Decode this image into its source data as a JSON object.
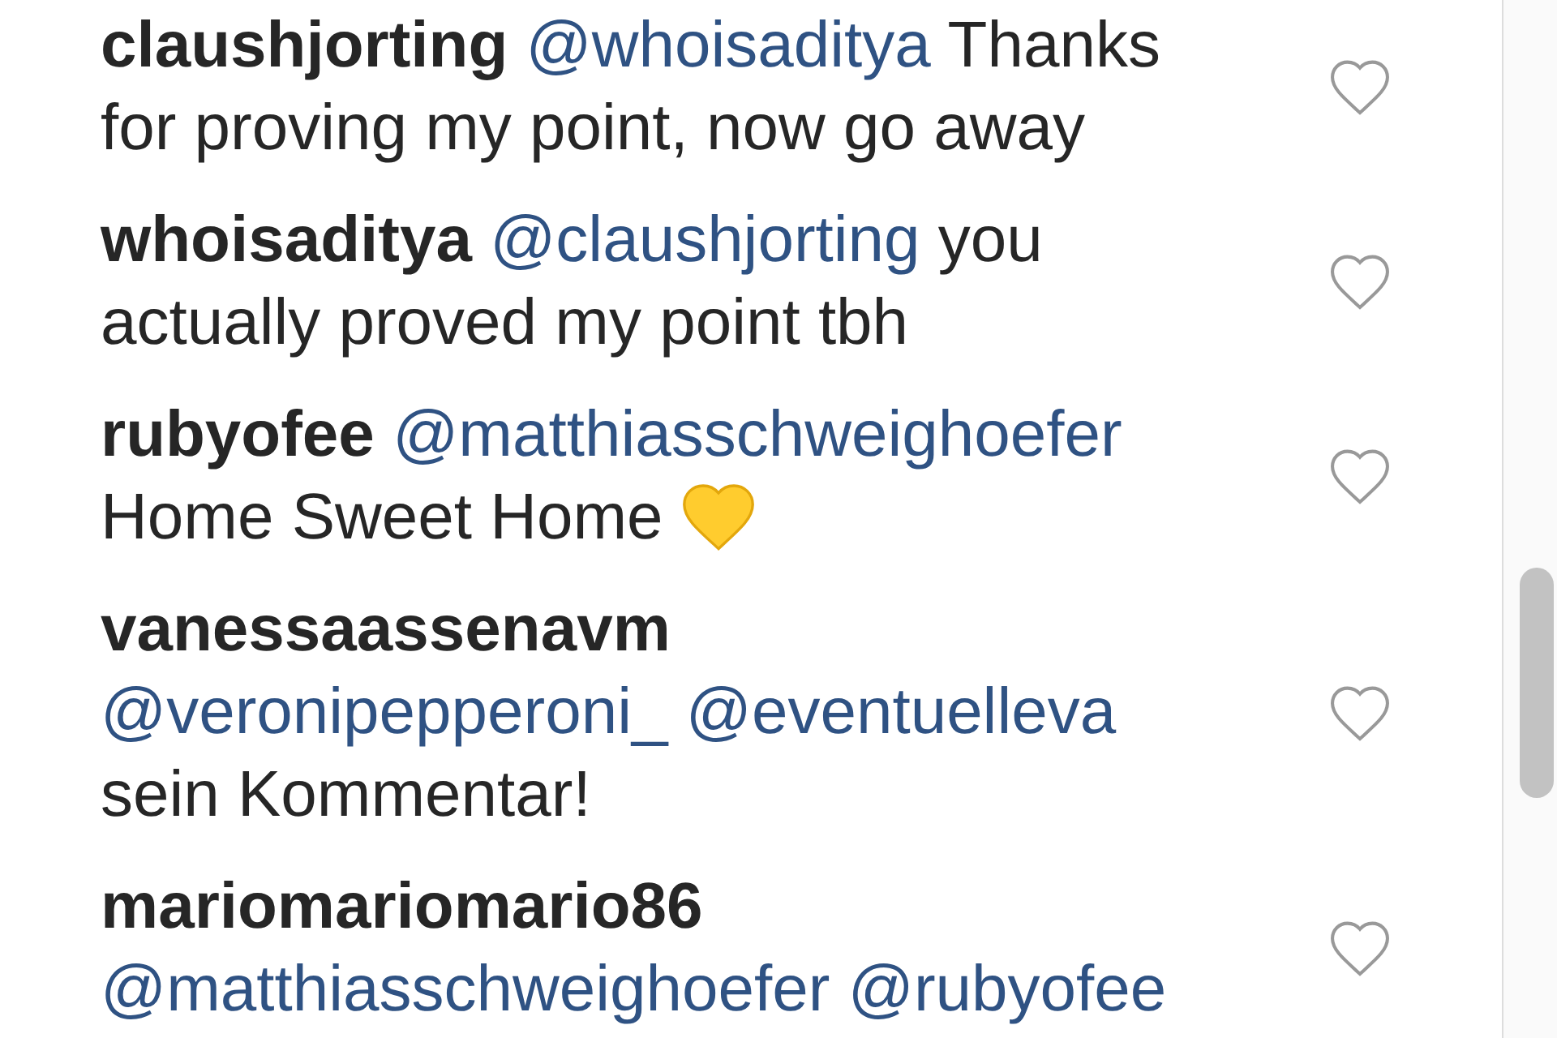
{
  "comments": [
    {
      "username": "claushjorting",
      "segments": [
        {
          "kind": "mention",
          "text": "@whoisaditya"
        },
        {
          "kind": "text",
          "text": "Thanks for proving my point, now go away"
        }
      ]
    },
    {
      "username": "whoisaditya",
      "segments": [
        {
          "kind": "mention",
          "text": "@claushjorting"
        },
        {
          "kind": "text",
          "text": "you actually proved my point tbh"
        }
      ]
    },
    {
      "username": "rubyofee",
      "segments": [
        {
          "kind": "mention",
          "text": "@matthiasschweighoefer"
        },
        {
          "kind": "text",
          "text": "Home Sweet Home"
        },
        {
          "kind": "emoji"
        }
      ]
    },
    {
      "username": "vanessaassenavm",
      "segments": [
        {
          "kind": "mention",
          "text": "@veronipepperoni_"
        },
        {
          "kind": "mention",
          "text": "@eventuelleva"
        },
        {
          "kind": "text",
          "text": "sein Kommentar!"
        }
      ]
    },
    {
      "username": "mariomariomario86",
      "segments": [
        {
          "kind": "mention",
          "text": "@matthiasschweighoefer"
        },
        {
          "kind": "mention",
          "text": "@rubyofee"
        }
      ]
    }
  ]
}
